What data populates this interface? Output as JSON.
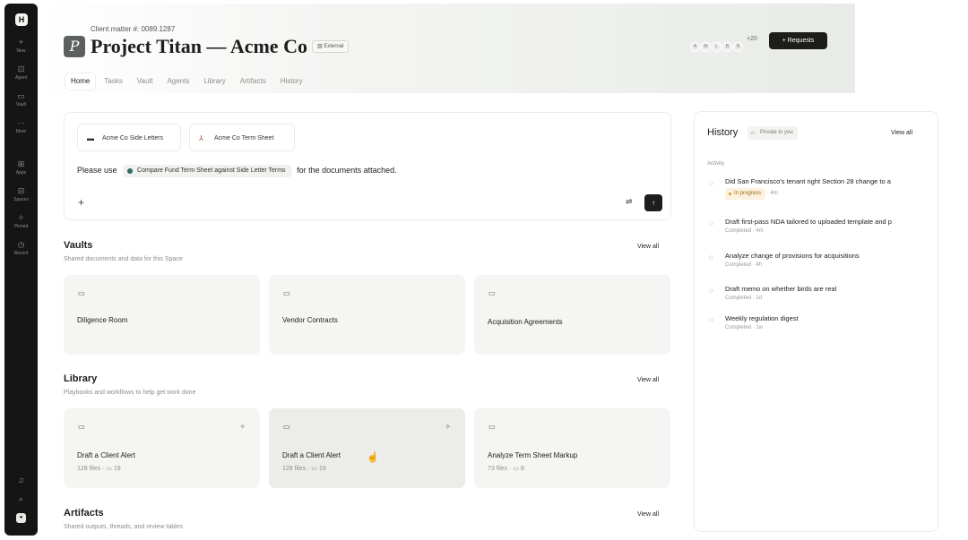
{
  "rail": {
    "logo": "H",
    "items": [
      {
        "icon": "plus-icon",
        "label": "New"
      },
      {
        "icon": "agent-icon",
        "label": "Agent"
      },
      {
        "icon": "vault-icon",
        "label": "Vault"
      },
      {
        "icon": "more-icon",
        "label": "More"
      },
      {
        "icon": "apps-icon",
        "label": "Apps"
      },
      {
        "icon": "spaces-icon",
        "label": "Spaces"
      },
      {
        "icon": "pin-icon",
        "label": "Pinned"
      },
      {
        "icon": "recent-icon",
        "label": "Recent"
      }
    ],
    "bottom": [
      "bell-icon",
      "search-icon"
    ]
  },
  "header": {
    "matter": "Client matter #: 0089.1287",
    "badge_letter": "P",
    "title": "Project Titan — Acme Co",
    "external": "External",
    "avatars": [
      "A",
      "M",
      "L",
      "B",
      "R"
    ],
    "avatars_more": "+20",
    "requests_label": "+ Requests",
    "tabs": [
      "Home",
      "Tasks",
      "Vault",
      "Agents",
      "Library",
      "Artifacts",
      "History"
    ],
    "active_tab": "Home"
  },
  "composer": {
    "attachments": [
      "Acme Co Side Letters",
      "Acme Co Term Sheet"
    ],
    "prompt_before": "Please use",
    "workflow": "Compare Fund Term Sheet against Side Letter Terms",
    "prompt_after": "for the documents attached."
  },
  "vaults": {
    "title": "Vaults",
    "subtitle": "Shared documents and data for this Space",
    "view_all": "View all",
    "cards": [
      "Diligence Room",
      "Vendor Contracts",
      "Acquisition Agreements"
    ]
  },
  "library": {
    "title": "Library",
    "subtitle": "Playbooks and workflows to help get work done",
    "view_all": "View all",
    "cards": [
      {
        "name": "Draft a Client Alert",
        "meta": "128 files · ▭ 19"
      },
      {
        "name": "Draft a Client Alert",
        "meta": "128 files · ▭ 19"
      },
      {
        "name": "Analyze Term Sheet Markup",
        "meta": "73 files · ▭ 8"
      }
    ]
  },
  "artifacts": {
    "title": "Artifacts",
    "subtitle": "Shared outputs, threads, and review tables",
    "view_all": "View all"
  },
  "history": {
    "title": "History",
    "private": "Private to you",
    "view_all": "View all",
    "activity_label": "Activity",
    "items": [
      {
        "title": "Did San Francisco's tenant right Section 28 change to a",
        "status": "In progress",
        "time": "4m"
      },
      {
        "title": "Draft first-pass NDA tailored to uploaded template and p",
        "status": "Completed · 4m"
      },
      {
        "title": "Analyze change of provisions for acquisitions",
        "status": "Completed · 4h"
      },
      {
        "title": "Draft memo on whether birds are real",
        "status": "Completed · 1d"
      },
      {
        "title": "Weekly regulation digest",
        "status": "Completed · 1w"
      }
    ]
  }
}
